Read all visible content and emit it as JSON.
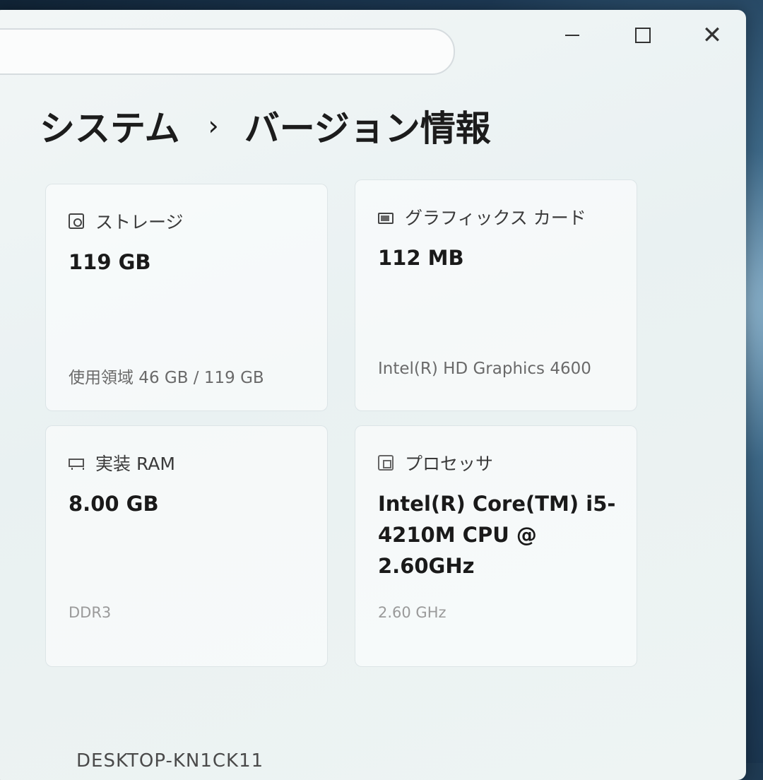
{
  "window": {
    "controls": {
      "minimize_icon": "minimize-icon",
      "maximize_icon": "maximize-icon",
      "close_icon": "close-icon",
      "close_glyph": "✕"
    }
  },
  "header": {
    "breadcrumb_parent": "システム",
    "breadcrumb_separator": "›",
    "breadcrumb_current": "バージョン情報"
  },
  "specs": {
    "storage": {
      "icon": "storage-icon",
      "label": "ストレージ",
      "value": "119 GB",
      "detail": "使用領域 46 GB / 119 GB"
    },
    "graphics": {
      "icon": "graphics-card-icon",
      "label": "グラフィックス カード",
      "value": "112 MB",
      "detail": "Intel(R) HD Graphics 4600"
    },
    "ram": {
      "icon": "ram-icon",
      "label": "実装 RAM",
      "value": "8.00 GB",
      "detail": "DDR3"
    },
    "processor": {
      "icon": "processor-icon",
      "label": "プロセッサ",
      "value": "Intel(R) Core(TM) i5-4210M CPU @ 2.60GHz",
      "detail": "2.60 GHz"
    }
  },
  "device": {
    "name": "DESKTOP-KN1CK11"
  },
  "colors": {
    "window_bg": "#eef4f3",
    "text_primary": "#1c1c1c",
    "text_secondary": "#6a6a6a"
  }
}
